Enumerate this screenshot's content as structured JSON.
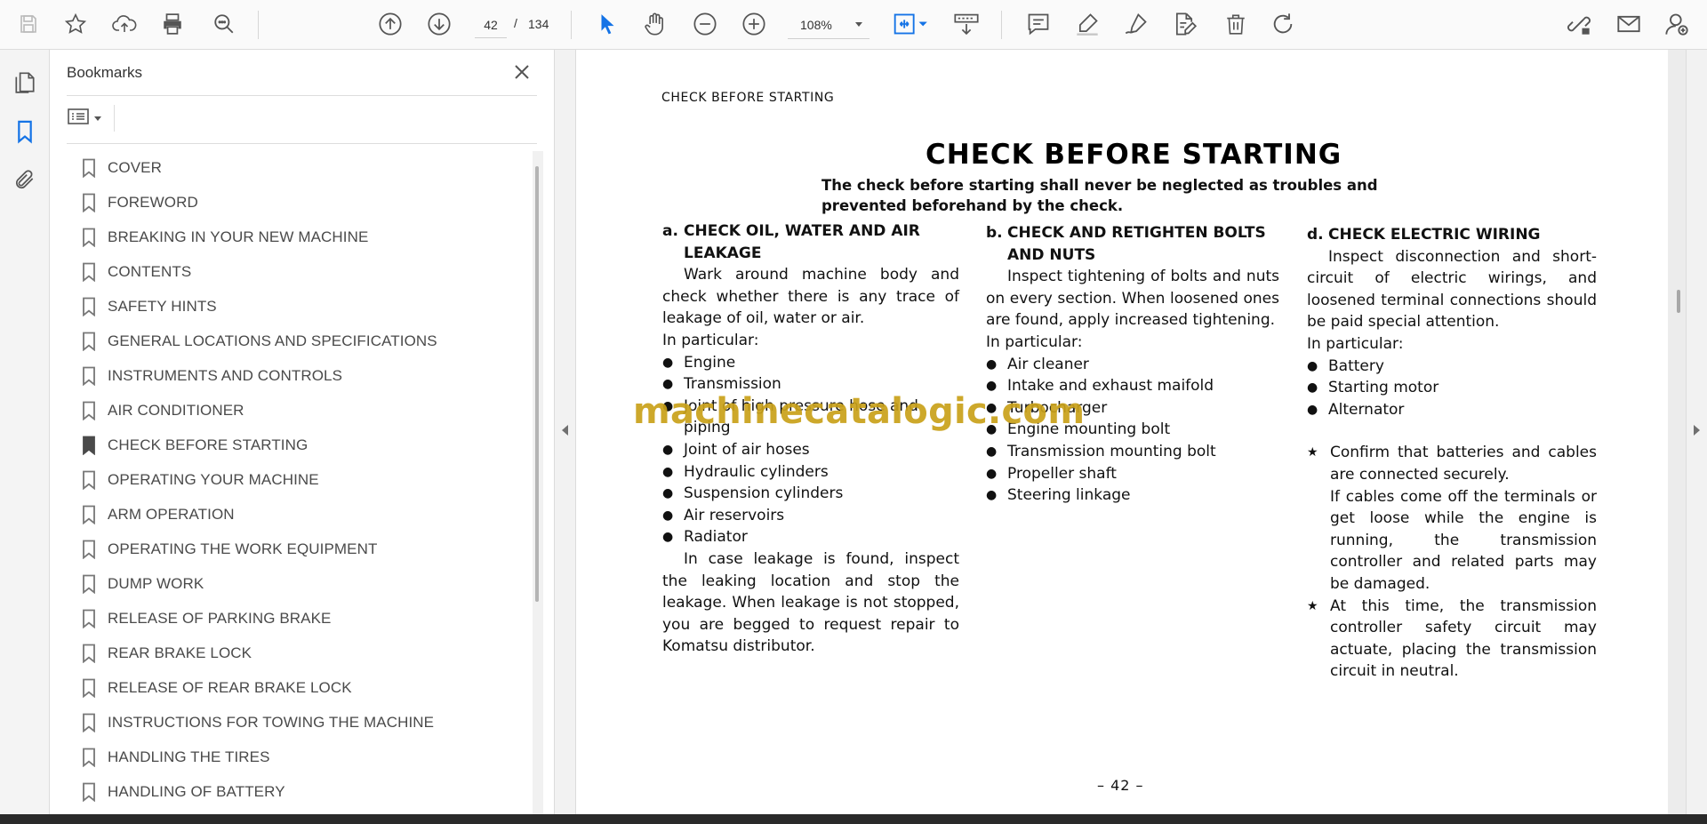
{
  "toolbar": {
    "icons": [
      "save-icon",
      "star-icon",
      "upload-icon",
      "print-icon",
      "search-zoom-icon",
      "prev-page-icon",
      "next-page-icon",
      "select-cursor-icon",
      "hand-icon",
      "zoom-out-icon",
      "zoom-in-icon",
      "fit-page-icon",
      "scroll-mode-icon",
      "comment-icon",
      "highlight-icon",
      "sign-icon",
      "edit-pdf-icon",
      "delete-icon",
      "rotate-icon",
      "share-link-icon",
      "mail-icon",
      "user-icon"
    ],
    "page_current": "42",
    "page_separator": "/",
    "page_total": "134",
    "zoom": "108%",
    "accent_color": "#1473e6"
  },
  "sidebar_rail": {
    "icons": [
      "pages-icon",
      "bookmark-icon",
      "attachment-icon"
    ]
  },
  "bookmarks": {
    "title": "Bookmarks",
    "active_item": "CHECK BEFORE STARTING",
    "items": [
      "COVER",
      "FOREWORD",
      "BREAKING IN YOUR NEW MACHINE",
      "CONTENTS",
      "SAFETY HINTS",
      "GENERAL LOCATIONS AND SPECIFICATIONS",
      "INSTRUMENTS AND CONTROLS",
      "AIR CONDITIONER",
      "CHECK BEFORE STARTING",
      "OPERATING YOUR MACHINE",
      "ARM OPERATION",
      "OPERATING THE WORK EQUIPMENT",
      "DUMP WORK",
      "RELEASE OF PARKING BRAKE",
      "REAR BRAKE LOCK",
      "RELEASE OF REAR BRAKE LOCK",
      "INSTRUCTIONS FOR TOWING THE MACHINE",
      "HANDLING THE TIRES",
      "HANDLING OF BATTERY"
    ]
  },
  "document": {
    "running_head": "CHECK BEFORE STARTING",
    "title": "CHECK BEFORE STARTING",
    "intro": "The check before starting shall never be neglected as troubles and prevented beforehand by the check.",
    "col_a": {
      "marker": "a.",
      "heading": "CHECK OIL, WATER AND AIR LEAKAGE",
      "para": "Wark around machine body and check whether there is any trace of leakage of oil, water or air.",
      "in_particular": "In particular:",
      "bullets": [
        "Engine",
        "Transmission",
        "Joint of high pressure hose and piping",
        "Joint of air hoses",
        "Hydraulic cylinders",
        "Suspension cylinders",
        "Air reservoirs",
        "Radiator"
      ],
      "closing": "In case leakage is found, inspect the leaking location and stop the leakage. When leakage is not stopped, you are begged to request repair to Komatsu distributor."
    },
    "col_b": {
      "marker": "b.",
      "heading": "CHECK AND RETIGHTEN BOLTS AND NUTS",
      "para": "Inspect tightening of bolts and nuts on every section. When loosened ones are found, apply increased tightening.",
      "in_particular": "In particular:",
      "bullets": [
        "Air cleaner",
        "Intake and exhaust maifold",
        "Turbocharger",
        "Engine mounting bolt",
        "Transmission mounting bolt",
        "Propeller shaft",
        "Steering linkage"
      ]
    },
    "col_d": {
      "marker": "d.",
      "heading": "CHECK ELECTRIC WIRING",
      "para": "Inspect disconnection and short-circuit of electric wirings, and loosened terminal connections should be paid special attention.",
      "in_particular": "In particular:",
      "bullets": [
        "Battery",
        "Starting motor",
        "Alternator"
      ],
      "notes": [
        "Confirm that batteries and cables are connected securely.",
        "If cables come off the terminals or get loose while the engine is running, the transmission controller and related parts may be damaged.",
        "At this time, the transmission controller safety circuit may actuate, placing the transmission circuit in neutral."
      ]
    },
    "page_label": "– 42 –",
    "watermark": "machinecatalogic.com"
  }
}
